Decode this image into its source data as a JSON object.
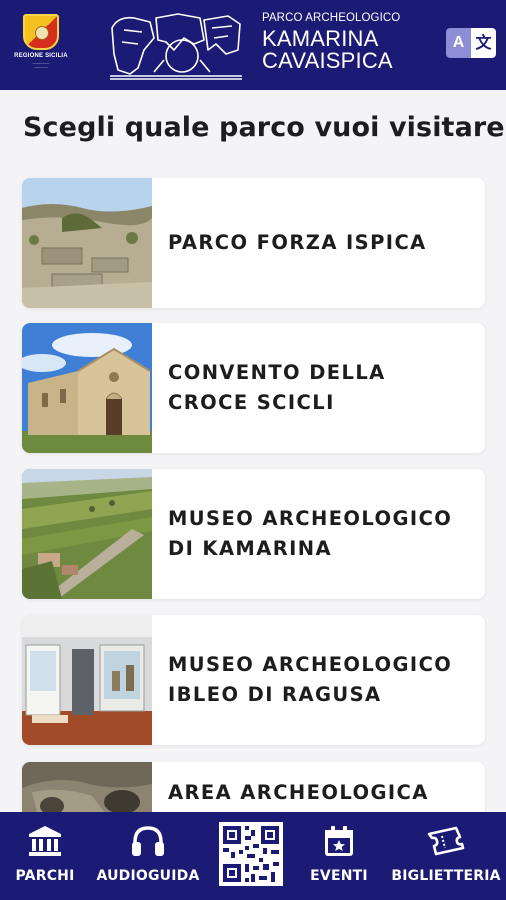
{
  "header": {
    "region_logo_title": "REGIONE SICILIA",
    "park_kicker": "PARCO ARCHEOLOGICO",
    "park_name_line1": "KAMARINA",
    "park_name_line2": "CAVAISPICA",
    "translate_icon_a": "A",
    "translate_icon_b": "文"
  },
  "page_title": "Scegli quale parco vuoi visitare",
  "parks": [
    {
      "label": "PARCO FORZA ISPICA",
      "image": "ruins-landscape"
    },
    {
      "label": "CONVENTO DELLA CROCE SCICLI",
      "image": "stone-church"
    },
    {
      "label": "MUSEO ARCHEOLOGICO DI KAMARINA",
      "image": "aerial-coast"
    },
    {
      "label": "MUSEO ARCHEOLOGICO IBLEO DI RAGUSA",
      "image": "museum-interior"
    },
    {
      "label": "AREA ARCHEOLOGICA",
      "image": "cave-interior"
    }
  ],
  "nav": {
    "items": [
      {
        "label": "PARCHI",
        "icon": "museum-icon"
      },
      {
        "label": "AUDIOGUIDA",
        "icon": "headphones-icon"
      },
      {
        "label": "",
        "icon": "qr-code-icon"
      },
      {
        "label": "EVENTI",
        "icon": "calendar-star-icon"
      },
      {
        "label": "BIGLIETTERIA",
        "icon": "ticket-icon"
      }
    ]
  },
  "colors": {
    "brand": "#1b1a74",
    "background": "#f4f4f6",
    "card": "#ffffff",
    "text": "#1d1d1f"
  }
}
